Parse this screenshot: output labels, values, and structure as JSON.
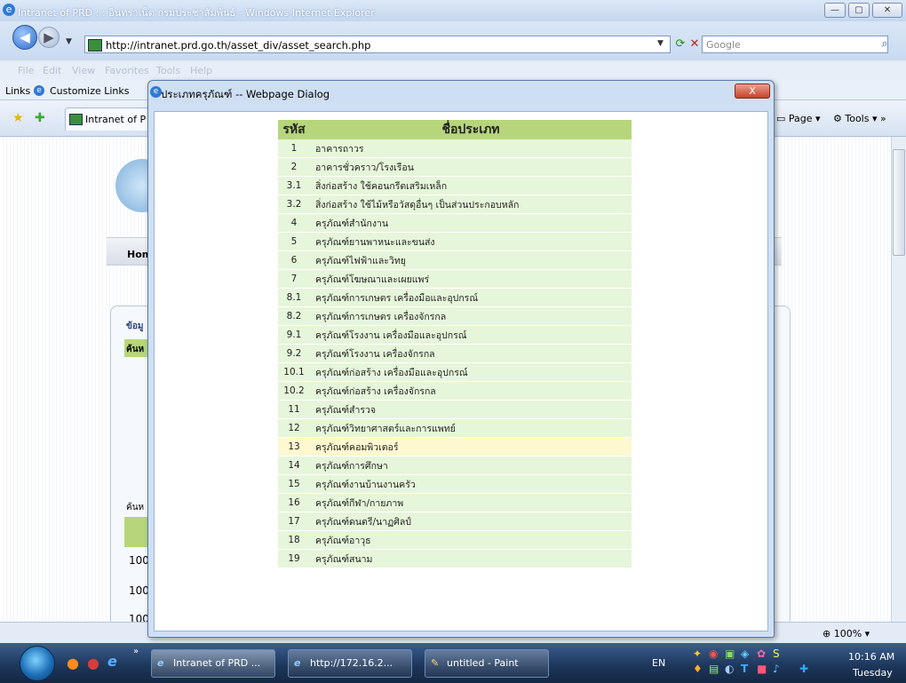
{
  "browser": {
    "title": "Intranet of PRD : : อินทราเน็ต กรมประชาสัมพันธ์ - Windows Internet Explorer",
    "url": "http://intranet.prd.go.th/asset_div/asset_search.php",
    "search_placeholder": "Google",
    "menu": [
      "File",
      "Edit",
      "View",
      "Favorites",
      "Tools",
      "Help"
    ],
    "links_label": "Links",
    "customize_links": "Customize Links",
    "tab_label": "Intranet of P",
    "page_menu": "Page",
    "tools_menu": "Tools",
    "zoom": "100%"
  },
  "background_page": {
    "home_text": "Hom",
    "data_label": "ข้อมู",
    "search_label": "ค้นห",
    "search_label2": "ค้นห",
    "row_values": [
      "100",
      "100",
      "100"
    ]
  },
  "dialog": {
    "title": "ประเภทครุภัณฑ์ -- Webpage Dialog",
    "close_label": "X",
    "table": {
      "headers": [
        "รหัส",
        "ชื่อประเภท"
      ],
      "rows": [
        {
          "code": "1",
          "name": "อาคารถาวร"
        },
        {
          "code": "2",
          "name": "อาคารชั่วคราว/โรงเรือน"
        },
        {
          "code": "3.1",
          "name": "สิ่งก่อสร้าง ใช้คอนกรีตเสริมเหล็ก"
        },
        {
          "code": "3.2",
          "name": "สิ่งก่อสร้าง ใช้ไม้หรือวัสดุอื่นๆ เป็นส่วนประกอบหลัก"
        },
        {
          "code": "4",
          "name": "ครุภัณฑ์สำนักงาน"
        },
        {
          "code": "5",
          "name": "ครุภัณฑ์ยานพาหนะและขนส่ง"
        },
        {
          "code": "6",
          "name": "ครุภัณฑ์ไฟฟ้าและวิทยุ"
        },
        {
          "code": "7",
          "name": "ครุภัณฑ์โฆษณาและเผยแพร่"
        },
        {
          "code": "8.1",
          "name": "ครุภัณฑ์การเกษตร เครื่องมือและอุปกรณ์"
        },
        {
          "code": "8.2",
          "name": "ครุภัณฑ์การเกษตร เครื่องจักรกล"
        },
        {
          "code": "9.1",
          "name": "ครุภัณฑ์โรงงาน เครื่องมือและอุปกรณ์"
        },
        {
          "code": "9.2",
          "name": "ครุภัณฑ์โรงงาน เครื่องจักรกล"
        },
        {
          "code": "10.1",
          "name": "ครุภัณฑ์ก่อสร้าง เครื่องมือและอุปกรณ์"
        },
        {
          "code": "10.2",
          "name": "ครุภัณฑ์ก่อสร้าง เครื่องจักรกล"
        },
        {
          "code": "11",
          "name": "ครุภัณฑ์สำรวจ"
        },
        {
          "code": "12",
          "name": "ครุภัณฑ์วิทยาศาสตร์และการแพทย์"
        },
        {
          "code": "13",
          "name": "ครุภัณฑ์คอมพิวเตอร์"
        },
        {
          "code": "14",
          "name": "ครุภัณฑ์การศึกษา"
        },
        {
          "code": "15",
          "name": "ครุภัณฑ์งานบ้านงานครัว"
        },
        {
          "code": "16",
          "name": "ครุภัณฑ์กีฬา/กายภาพ"
        },
        {
          "code": "17",
          "name": "ครุภัณฑ์ดนตรี/นาฏศิลป์"
        },
        {
          "code": "18",
          "name": "ครุภัณฑ์อาวุธ"
        },
        {
          "code": "19",
          "name": "ครุภัณฑ์สนาม"
        }
      ],
      "highlighted_code": "13"
    }
  },
  "taskbar": {
    "tasks": [
      "Intranet of PRD ...",
      "http://172.16.2...",
      "untitled - Paint"
    ],
    "language": "EN",
    "time": "10:16 AM",
    "day": "Tuesday"
  },
  "colors": {
    "header_green": "#b7d67b",
    "row_green": "#e6f6da",
    "row_highlight": "#fdf8cf"
  }
}
